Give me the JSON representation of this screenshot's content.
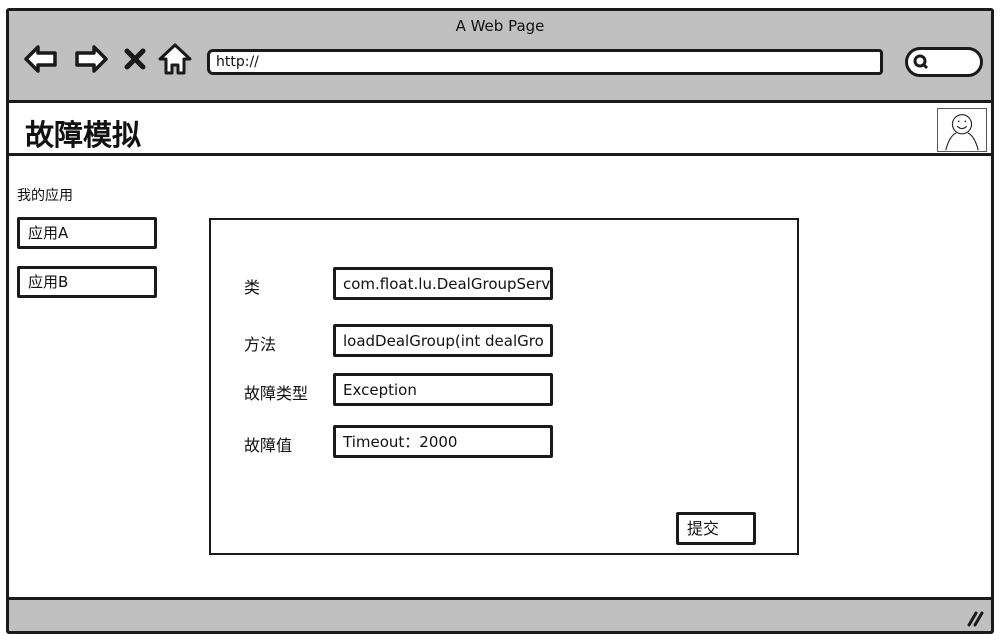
{
  "browser": {
    "window_title": "A Web Page",
    "url": "http://",
    "icons": {
      "back": "back-arrow-icon",
      "forward": "forward-arrow-icon",
      "stop": "stop-x-icon",
      "home": "home-icon",
      "search": "search-icon",
      "resize": "resize-grip-icon"
    }
  },
  "header": {
    "title": "故障模拟",
    "avatar": "user-avatar-icon"
  },
  "sidebar": {
    "label": "我的应用",
    "items": [
      {
        "label": "应用A"
      },
      {
        "label": "应用B"
      }
    ]
  },
  "form": {
    "fields": [
      {
        "label": "类",
        "value": "com.float.lu.DealGroupServ"
      },
      {
        "label": "方法",
        "value": "loadDealGroup(int dealGro"
      },
      {
        "label": "故障类型",
        "value": "Exception"
      },
      {
        "label": "故障值",
        "value": "Timeout：2000"
      }
    ],
    "submit_label": "提交"
  }
}
